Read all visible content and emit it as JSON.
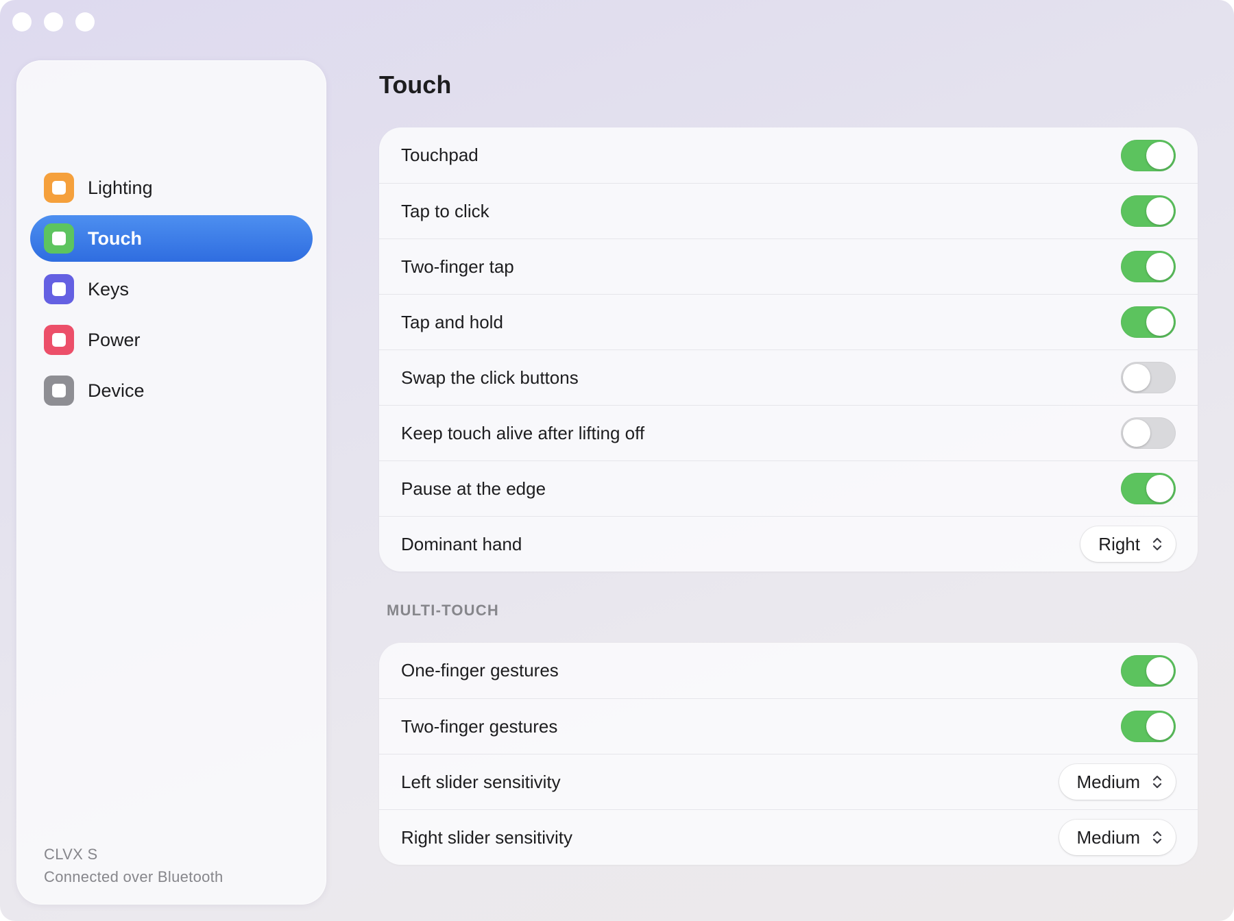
{
  "window": {
    "controls": [
      "close",
      "minimize",
      "zoom"
    ]
  },
  "sidebar": {
    "items": [
      {
        "label": "Lighting",
        "icon": "lighting-icon",
        "color": "#f5a03c",
        "selected": false
      },
      {
        "label": "Touch",
        "icon": "touch-icon",
        "color": "#5dc45f",
        "selected": true
      },
      {
        "label": "Keys",
        "icon": "keys-icon",
        "color": "#6460e2",
        "selected": false
      },
      {
        "label": "Power",
        "icon": "power-icon",
        "color": "#ec4f69",
        "selected": false
      },
      {
        "label": "Device",
        "icon": "device-icon",
        "color": "#8e8e93",
        "selected": false
      }
    ],
    "device_name": "CLVX S",
    "connection_status": "Connected over Bluetooth"
  },
  "main": {
    "title": "Touch",
    "touch_group": {
      "rows": [
        {
          "label": "Touchpad",
          "type": "toggle",
          "on": true
        },
        {
          "label": "Tap to click",
          "type": "toggle",
          "on": true
        },
        {
          "label": "Two-finger tap",
          "type": "toggle",
          "on": true
        },
        {
          "label": "Tap and hold",
          "type": "toggle",
          "on": true
        },
        {
          "label": "Swap the click buttons",
          "type": "toggle",
          "on": false
        },
        {
          "label": "Keep touch alive after lifting off",
          "type": "toggle",
          "on": false
        },
        {
          "label": "Pause at the edge",
          "type": "toggle",
          "on": true
        },
        {
          "label": "Dominant hand",
          "type": "select",
          "value": "Right"
        }
      ]
    },
    "multitouch_header": "MULTI-TOUCH",
    "multitouch_group": {
      "rows": [
        {
          "label": "One-finger gestures",
          "type": "toggle",
          "on": true
        },
        {
          "label": "Two-finger gestures",
          "type": "toggle",
          "on": true
        },
        {
          "label": "Left slider sensitivity",
          "type": "select",
          "value": "Medium"
        },
        {
          "label": "Right slider sensitivity",
          "type": "select",
          "value": "Medium"
        }
      ]
    }
  },
  "colors": {
    "accent": "#3a7be6",
    "toggle_on": "#5cc35e",
    "toggle_off": "#d9d9dc"
  }
}
